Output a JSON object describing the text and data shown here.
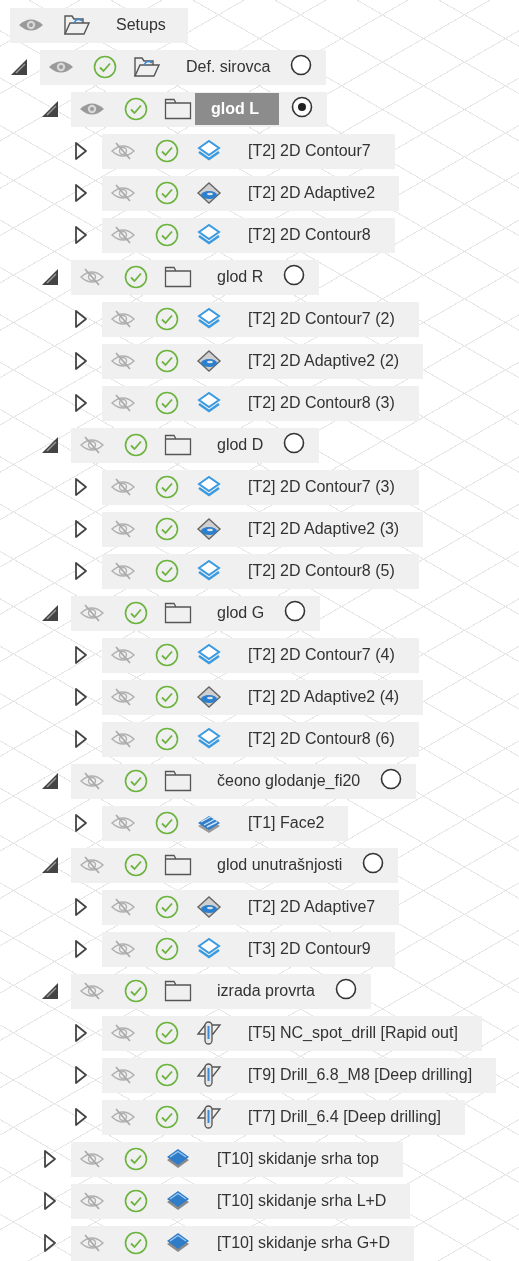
{
  "tree": {
    "kind": "root",
    "label": "Setups",
    "visible": true,
    "children": [
      {
        "kind": "setup",
        "label": "Def. sirovca",
        "visible": true,
        "generated": true,
        "expanded": true,
        "selected": false,
        "active": false,
        "children": [
          {
            "kind": "folder",
            "label": "glod L",
            "visible": true,
            "generated": true,
            "expanded": true,
            "selected": true,
            "active": true,
            "children": [
              {
                "kind": "contour",
                "label": "[T2] 2D Contour7",
                "visible": false,
                "generated": true,
                "expanded": false,
                "selected": false
              },
              {
                "kind": "adaptive",
                "label": "[T2] 2D Adaptive2",
                "visible": false,
                "generated": true,
                "expanded": false,
                "selected": false
              },
              {
                "kind": "contour",
                "label": "[T2] 2D Contour8",
                "visible": false,
                "generated": true,
                "expanded": false,
                "selected": false
              }
            ]
          },
          {
            "kind": "folder",
            "label": "glod R",
            "visible": false,
            "generated": true,
            "expanded": true,
            "selected": false,
            "active": false,
            "children": [
              {
                "kind": "contour",
                "label": "[T2] 2D Contour7 (2)",
                "visible": false,
                "generated": true,
                "expanded": false,
                "selected": false
              },
              {
                "kind": "adaptive",
                "label": "[T2] 2D Adaptive2 (2)",
                "visible": false,
                "generated": true,
                "expanded": false,
                "selected": false
              },
              {
                "kind": "contour",
                "label": "[T2] 2D Contour8 (3)",
                "visible": false,
                "generated": true,
                "expanded": false,
                "selected": false
              }
            ]
          },
          {
            "kind": "folder",
            "label": "glod D",
            "visible": false,
            "generated": true,
            "expanded": true,
            "selected": false,
            "active": false,
            "children": [
              {
                "kind": "contour",
                "label": "[T2] 2D Contour7 (3)",
                "visible": false,
                "generated": true,
                "expanded": false,
                "selected": false
              },
              {
                "kind": "adaptive",
                "label": "[T2] 2D Adaptive2 (3)",
                "visible": false,
                "generated": true,
                "expanded": false,
                "selected": false
              },
              {
                "kind": "contour",
                "label": "[T2] 2D Contour8 (5)",
                "visible": false,
                "generated": true,
                "expanded": false,
                "selected": false
              }
            ]
          },
          {
            "kind": "folder",
            "label": "glod G",
            "visible": false,
            "generated": true,
            "expanded": true,
            "selected": false,
            "active": false,
            "children": [
              {
                "kind": "contour",
                "label": "[T2] 2D Contour7 (4)",
                "visible": false,
                "generated": true,
                "expanded": false,
                "selected": false
              },
              {
                "kind": "adaptive",
                "label": "[T2] 2D Adaptive2 (4)",
                "visible": false,
                "generated": true,
                "expanded": false,
                "selected": false
              },
              {
                "kind": "contour",
                "label": "[T2] 2D Contour8 (6)",
                "visible": false,
                "generated": true,
                "expanded": false,
                "selected": false
              }
            ]
          },
          {
            "kind": "folder",
            "label": "čeono glodanje_fi20",
            "visible": false,
            "generated": true,
            "expanded": true,
            "selected": false,
            "active": false,
            "children": [
              {
                "kind": "face",
                "label": "[T1] Face2",
                "visible": false,
                "generated": true,
                "expanded": false,
                "selected": false
              }
            ]
          },
          {
            "kind": "folder",
            "label": "glod unutrašnjosti",
            "visible": false,
            "generated": true,
            "expanded": true,
            "selected": false,
            "active": false,
            "children": [
              {
                "kind": "adaptive",
                "label": "[T2] 2D Adaptive7",
                "visible": false,
                "generated": true,
                "expanded": false,
                "selected": false
              },
              {
                "kind": "contour",
                "label": "[T3] 2D Contour9",
                "visible": false,
                "generated": true,
                "expanded": false,
                "selected": false
              }
            ]
          },
          {
            "kind": "folder",
            "label": "izrada provrta",
            "visible": false,
            "generated": true,
            "expanded": true,
            "selected": false,
            "active": false,
            "children": [
              {
                "kind": "drill",
                "label": "[T5] NC_spot_drill [Rapid out]",
                "visible": false,
                "generated": true,
                "expanded": false,
                "selected": false
              },
              {
                "kind": "drill",
                "label": "[T9] Drill_6.8_M8 [Deep drilling]",
                "visible": false,
                "generated": true,
                "expanded": false,
                "selected": false
              },
              {
                "kind": "drill",
                "label": "[T7] Drill_6.4 [Deep drilling]",
                "visible": false,
                "generated": true,
                "expanded": false,
                "selected": false
              }
            ]
          },
          {
            "kind": "deburr",
            "label": "[T10] skidanje srha top",
            "visible": false,
            "generated": true,
            "expanded": false,
            "selected": false
          },
          {
            "kind": "deburr",
            "label": "[T10] skidanje srha L+D",
            "visible": false,
            "generated": true,
            "expanded": false,
            "selected": false
          },
          {
            "kind": "deburr",
            "label": "[T10] skidanje srha G+D",
            "visible": false,
            "generated": true,
            "expanded": false,
            "selected": false
          }
        ]
      }
    ]
  }
}
